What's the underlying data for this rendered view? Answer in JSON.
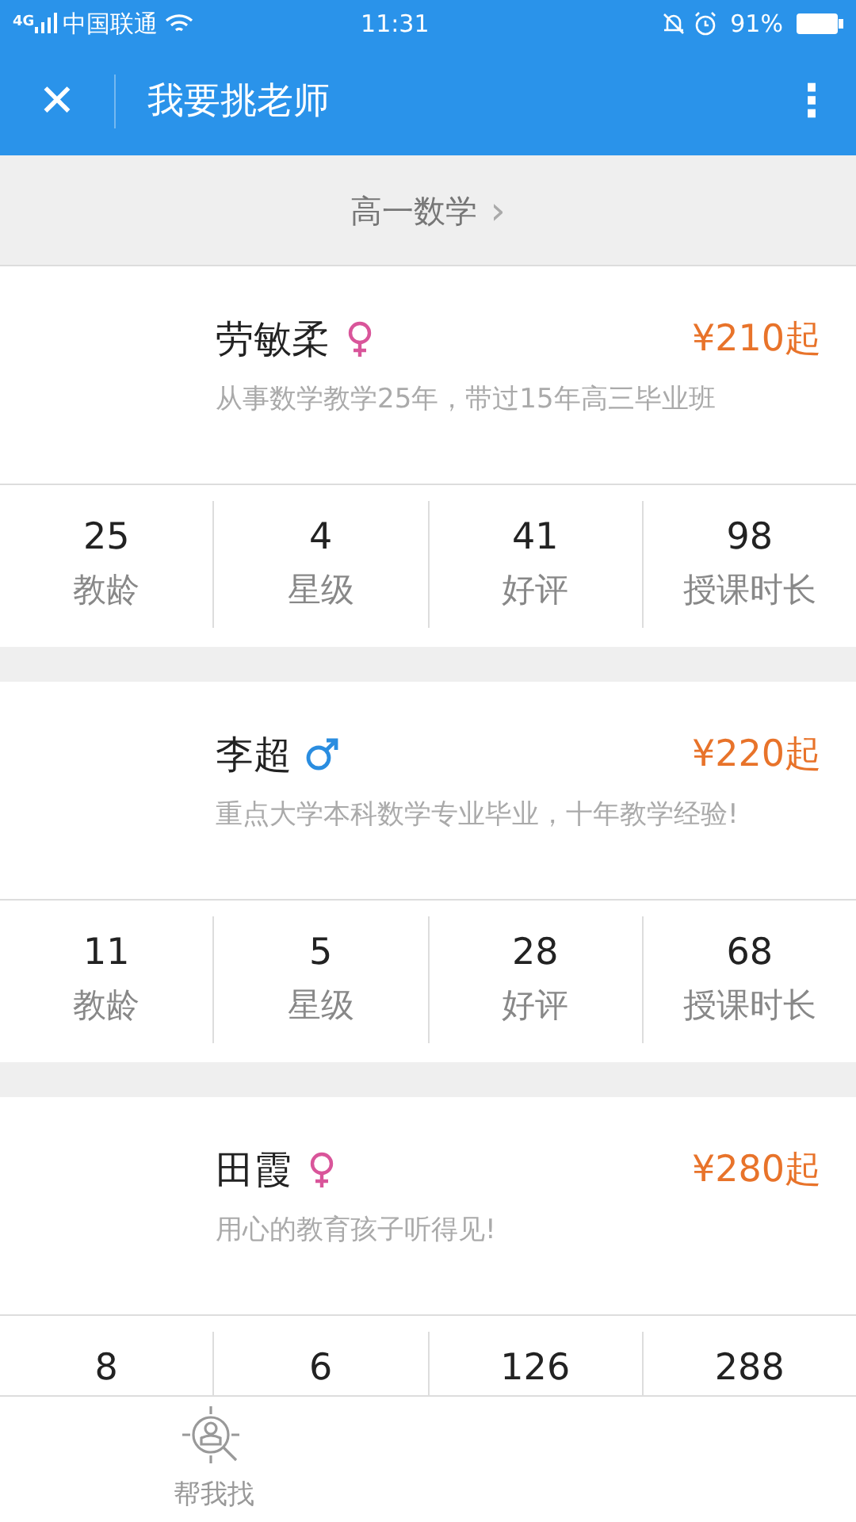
{
  "status_bar": {
    "carrier": "中国联通",
    "network": "4G",
    "time": "11:31",
    "battery": "91%"
  },
  "app_bar": {
    "close": "✕",
    "title": "我要挑老师",
    "menu": "⋮"
  },
  "subject": {
    "label": "高一数学",
    "chevron": "›"
  },
  "teachers": [
    {
      "name": "劳敏柔",
      "kind": "female",
      "price": "¥210起",
      "intro": "从事数学教学25年，带过15年高三毕业班",
      "stats": [
        {
          "value": "25",
          "label": "教龄"
        },
        {
          "value": "4",
          "label": "星级"
        },
        {
          "value": "41",
          "label": "好评"
        },
        {
          "value": "98",
          "label": "授课时长"
        }
      ]
    },
    {
      "name": "李超",
      "kind": "male",
      "price": "¥220起",
      "intro": "重点大学本科数学专业毕业，十年教学经验!",
      "stats": [
        {
          "value": "11",
          "label": "教龄"
        },
        {
          "value": "5",
          "label": "星级"
        },
        {
          "value": "28",
          "label": "好评"
        },
        {
          "value": "68",
          "label": "授课时长"
        }
      ]
    },
    {
      "name": "田霞",
      "kind": "female",
      "price": "¥280起",
      "intro": "用心的教育孩子听得见!",
      "stats": [
        {
          "value": "8"
        },
        {
          "value": "6"
        },
        {
          "value": "126"
        },
        {
          "value": "288"
        }
      ]
    }
  ],
  "tab_bar": [
    {
      "label": "帮我找"
    }
  ]
}
